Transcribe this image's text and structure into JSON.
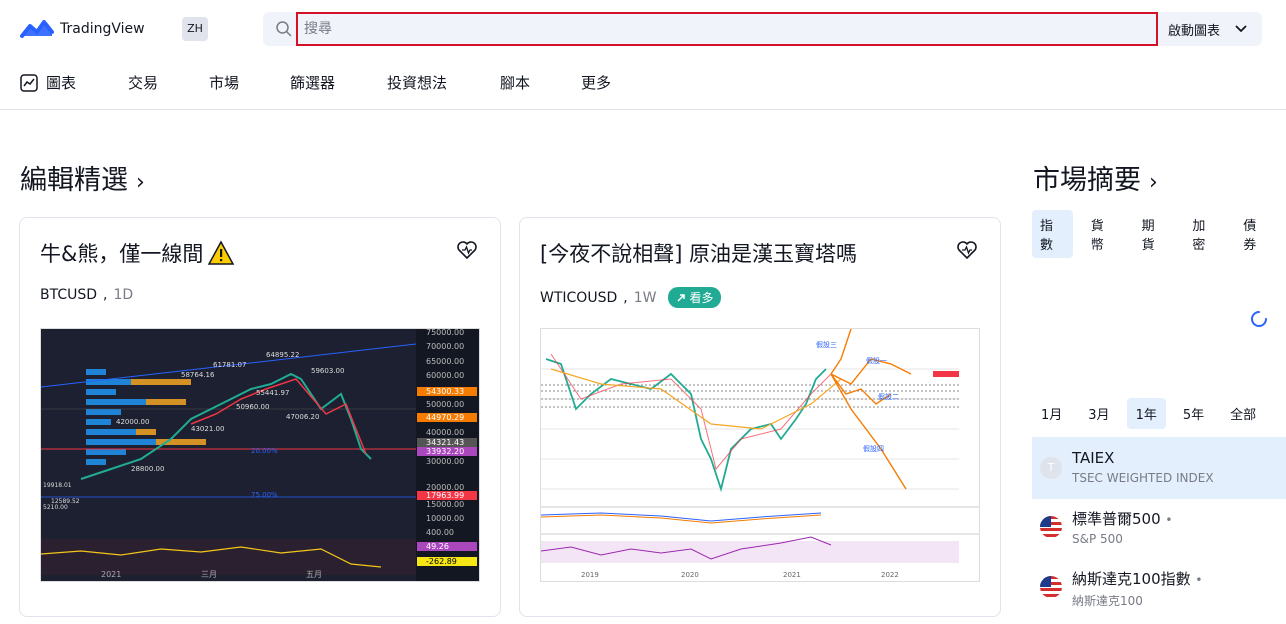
{
  "header": {
    "logo_text": "TradingView",
    "lang": "ZH",
    "search_placeholder": "搜尋",
    "launch_label": "啟動圖表"
  },
  "nav": {
    "items": [
      {
        "label": "圖表",
        "icon": "chart-icon"
      },
      {
        "label": "交易"
      },
      {
        "label": "市場"
      },
      {
        "label": "篩選器"
      },
      {
        "label": "投資想法"
      },
      {
        "label": "腳本"
      },
      {
        "label": "更多"
      }
    ]
  },
  "editors_pick": {
    "title": "編輯精選",
    "cards": [
      {
        "title": "牛&熊，僅一線間",
        "symbol": "BTCUSD",
        "timeframe": "1D"
      },
      {
        "title": "[今夜不說相聲] 原油是漢玉寶塔嗎",
        "symbol": "WTICOUSD",
        "timeframe": "1W",
        "badge": "看多"
      }
    ]
  },
  "btc_chart": {
    "price_labels": [
      "75000.00",
      "70000.00",
      "65000.00",
      "60000.00",
      "54300.33",
      "50000.00",
      "44970.29",
      "40000.00",
      "34321.43",
      "33932.20",
      "30000.00",
      "20000.00",
      "17963.99",
      "15000.00",
      "10000.00",
      "400.00",
      "49.26",
      "-262.89"
    ],
    "annotations": [
      "64895.22",
      "61781.07",
      "58764.16",
      "55441.97",
      "59603.00",
      "50960.00",
      "47006.20",
      "43021.00",
      "42000.00",
      "28800.00",
      "20.00%",
      "75.00%",
      "19918.01",
      "12589.52",
      "5210.00"
    ],
    "x_labels": [
      "2021",
      "三月",
      "五月"
    ]
  },
  "oil_chart": {
    "annotations": [
      "假設三",
      "假設一",
      "假設二",
      "假設四"
    ],
    "x_labels": [
      "2019",
      "2020",
      "2021",
      "2022"
    ]
  },
  "market_summary": {
    "title": "市場摘要",
    "tabs": [
      "指數",
      "貨幣",
      "期貨",
      "加密",
      "債券"
    ],
    "active_tab": "指數",
    "periods": [
      "1月",
      "3月",
      "1年",
      "5年",
      "全部"
    ],
    "active_period": "1年",
    "rows": [
      {
        "name": "TAIEX",
        "sub": "TSEC WEIGHTED INDEX",
        "flag": "T"
      },
      {
        "name": "標準普爾500",
        "sub": "S&P 500",
        "flag": "us-flag"
      },
      {
        "name": "納斯達克100指數",
        "sub": "納斯達克100",
        "flag": "us-flag"
      }
    ]
  },
  "colors": {
    "accent": "#2962ff",
    "search_highlight": "#d3122a",
    "bull": "#22ab94",
    "bear": "#f23645"
  }
}
